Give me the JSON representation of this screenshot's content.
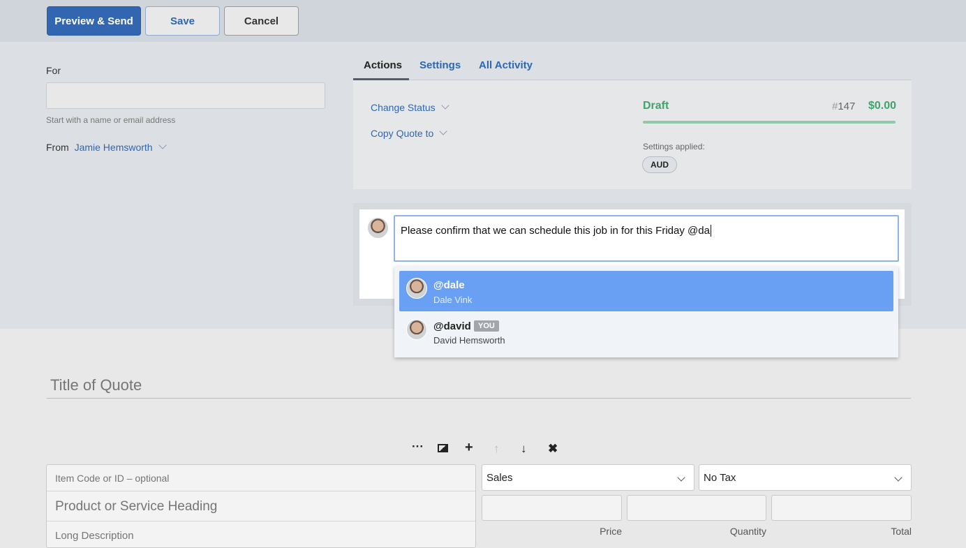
{
  "toolbar": {
    "preview_send": "Preview & Send",
    "save": "Save",
    "cancel": "Cancel"
  },
  "for": {
    "label": "For",
    "value": "",
    "hint": "Start with a name or email address"
  },
  "from": {
    "label": "From",
    "value": "Jamie Hemsworth"
  },
  "tabs": [
    {
      "label": "Actions",
      "active": true
    },
    {
      "label": "Settings"
    },
    {
      "label": "All Activity"
    }
  ],
  "actions": {
    "change_status": "Change Status",
    "copy_quote": "Copy Quote to"
  },
  "status": {
    "label": "Draft",
    "number_prefix": "#",
    "number": "147",
    "amount": "$0.00",
    "color": "#3fa36b",
    "settings_label": "Settings applied:",
    "currency_badge": "AUD"
  },
  "comment": {
    "text": "Please confirm that we can schedule this job in for this Friday @da"
  },
  "mentions": [
    {
      "handle": "@dale",
      "name": "Dale Vink",
      "selected": true
    },
    {
      "handle": "@david",
      "name": "David Hemsworth",
      "badge": "YOU"
    }
  ],
  "quote": {
    "title_placeholder": "Title of Quote"
  },
  "item_toolbar": {
    "icons": [
      "more-icon",
      "image-icon",
      "plus-icon",
      "arrow-up-icon",
      "arrow-down-icon",
      "close-icon"
    ]
  },
  "item": {
    "code_placeholder": "Item Code or ID – optional",
    "heading_placeholder": "Product or Service Heading",
    "description_placeholder": "Long Description",
    "account": "Sales",
    "tax": "No Tax",
    "price_label": "Price",
    "quantity_label": "Quantity",
    "total_label": "Total"
  }
}
